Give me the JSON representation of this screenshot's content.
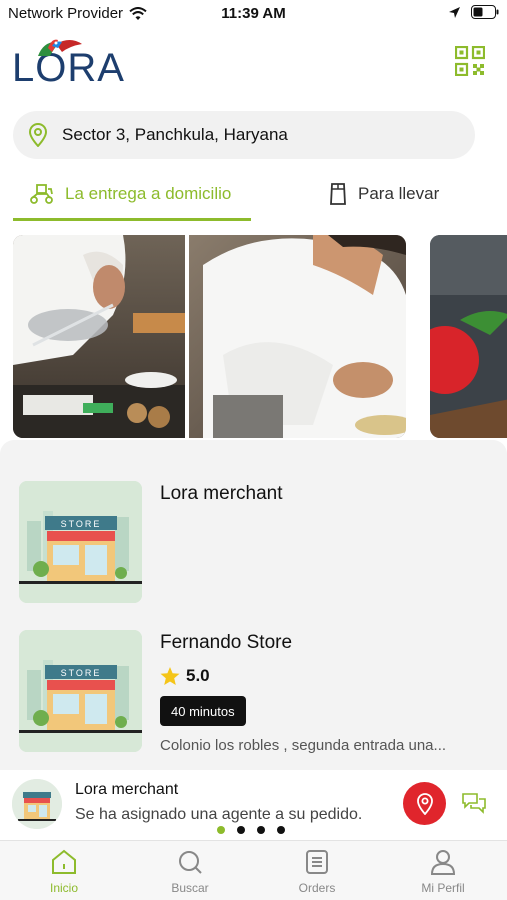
{
  "status_bar": {
    "carrier": "Network Provider",
    "time": "11:39 AM"
  },
  "brand": {
    "name": "LORA",
    "accent_color": "#8dbb2c",
    "brand_color": "#1d3e6e"
  },
  "header": {
    "qr_icon": "qr-code-icon"
  },
  "location": {
    "address": "Sector 3, Panchkula, Haryana",
    "icon": "location-pin-icon"
  },
  "tabs": [
    {
      "label": "La entrega a domicilio",
      "icon": "delivery-scooter-icon",
      "active": true
    },
    {
      "label": "Para llevar",
      "icon": "takeaway-bag-icon",
      "active": false
    }
  ],
  "stores": [
    {
      "name": "Lora merchant"
    },
    {
      "name": "Fernando Store",
      "rating": "5.0",
      "delivery_time": "40 minutos",
      "address": "Colonio los robles , segunda entrada una..."
    }
  ],
  "store_image_label": "STORE",
  "notification": {
    "title": "Lora merchant",
    "message": "Se ha asignado una agente a su pedido."
  },
  "carousel": {
    "count": 4,
    "active_index": 0
  },
  "bottom_nav": [
    {
      "label": "Inicio",
      "icon": "home-icon",
      "active": true
    },
    {
      "label": "Buscar",
      "icon": "search-icon",
      "active": false
    },
    {
      "label": "Orders",
      "icon": "orders-list-icon",
      "active": false
    },
    {
      "label": "Mi Perfil",
      "icon": "profile-icon",
      "active": false
    }
  ]
}
